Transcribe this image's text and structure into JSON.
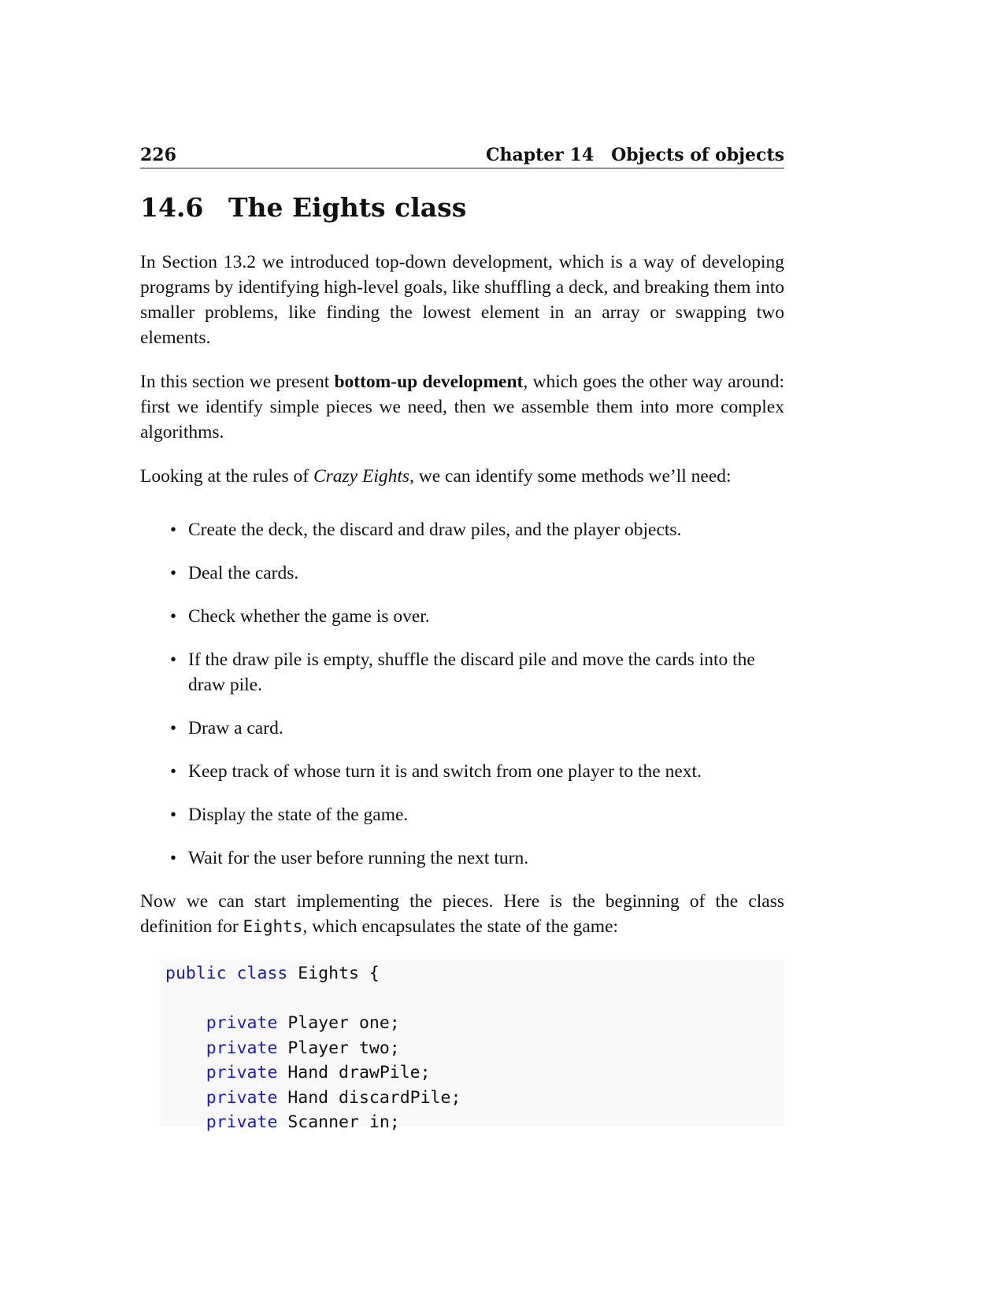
{
  "header": {
    "page_number": "226",
    "chapter_label": "Chapter 14",
    "chapter_title": "Objects of objects"
  },
  "section": {
    "number": "14.6",
    "title": "The Eights class"
  },
  "paragraphs": {
    "p1": "In Section 13.2 we introduced top-down development, which is a way of developing programs by identifying high-level goals, like shuffling a deck, and breaking them into smaller problems, like finding the lowest element in an array or swapping two elements.",
    "p2_before": "In this section we present ",
    "p2_bold": "bottom-up development",
    "p2_after": ", which goes the other way around: first we identify simple pieces we need, then we assemble them into more complex algorithms.",
    "p3_before": "Looking at the rules of ",
    "p3_italic": "Crazy Eights",
    "p3_after": ", we can identify some methods we’ll need:",
    "p4_before": "Now we can start implementing the pieces. Here is the beginning of the class definition for ",
    "p4_code": "Eights",
    "p4_after": ", which encapsulates the state of the game:"
  },
  "bullets": [
    "Create the deck, the discard and draw piles, and the player objects.",
    "Deal the cards.",
    "Check whether the game is over.",
    "If the draw pile is empty, shuffle the discard pile and move the cards into the draw pile.",
    "Draw a card.",
    "Keep track of whose turn it is and switch from one player to the next.",
    "Display the state of the game.",
    "Wait for the user before running the next turn."
  ],
  "code": {
    "line1_kw": "public class",
    "line1_rest": " Eights {",
    "fields": [
      {
        "kw": "private",
        "rest": " Player one;"
      },
      {
        "kw": "private",
        "rest": " Player two;"
      },
      {
        "kw": "private",
        "rest": " Hand drawPile;"
      },
      {
        "kw": "private",
        "rest": " Hand discardPile;"
      },
      {
        "kw": "private",
        "rest": " Scanner in;"
      }
    ],
    "keyword_color": "#1a1acc",
    "background_color": "#f8f8f8"
  }
}
